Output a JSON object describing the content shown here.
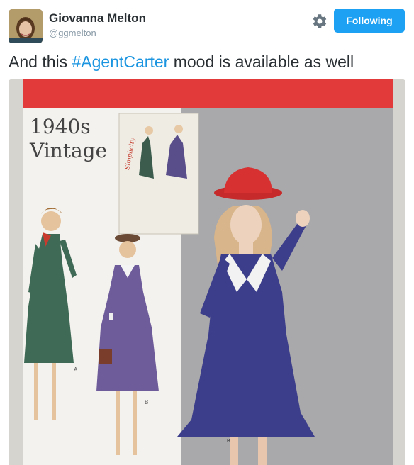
{
  "user": {
    "name": "Giovanna Melton",
    "handle": "@ggmelton"
  },
  "follow_button": {
    "label": "Following"
  },
  "tweet": {
    "text_before": "And this ",
    "hashtag": "#AgentCarter",
    "text_after": " mood is available as well"
  },
  "photo": {
    "cover_title_line1": "1940s",
    "cover_title_line2": "Vintage",
    "brand_text": "Simplicity",
    "view_a": "A",
    "view_b": "B",
    "view_b_photo": "B"
  },
  "colors": {
    "accent": "#1da1f2",
    "hashtag": "#1b95e0",
    "pattern_red": "#e23a3a",
    "dress_blue": "#3c3e8c"
  }
}
